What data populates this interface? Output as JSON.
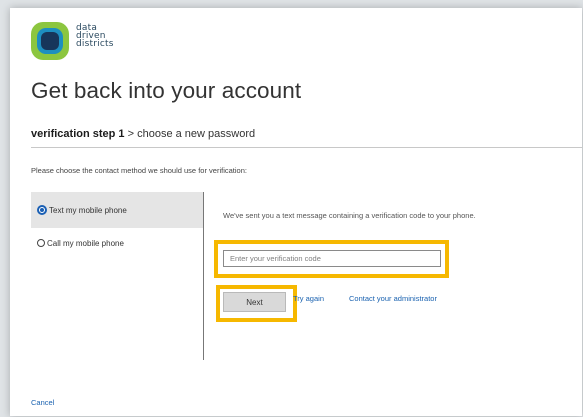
{
  "logo": {
    "lines": [
      "data",
      "driven",
      "districts"
    ],
    "colors": {
      "ring": "#8cc63f",
      "inner": "#1d8fc0"
    }
  },
  "page": {
    "title": "Get back into your account",
    "instruction": "Please choose the contact method we should use for verification:"
  },
  "steps": {
    "active": "verification step 1",
    "separator": ">",
    "next": "choose a new password"
  },
  "methods": [
    {
      "label": "Text my mobile phone",
      "selected": true
    },
    {
      "label": "Call my mobile phone",
      "selected": false
    }
  ],
  "verify": {
    "message": "We've sent you a text message containing a verification code to your phone.",
    "placeholder": "Enter your verification code",
    "value": "",
    "next_label": "Next",
    "try_again_label": "Try again",
    "contact_admin_label": "Contact your administrator"
  },
  "footer": {
    "cancel_label": "Cancel"
  },
  "highlight_color": "#f6b800",
  "link_color": "#1a62b0"
}
